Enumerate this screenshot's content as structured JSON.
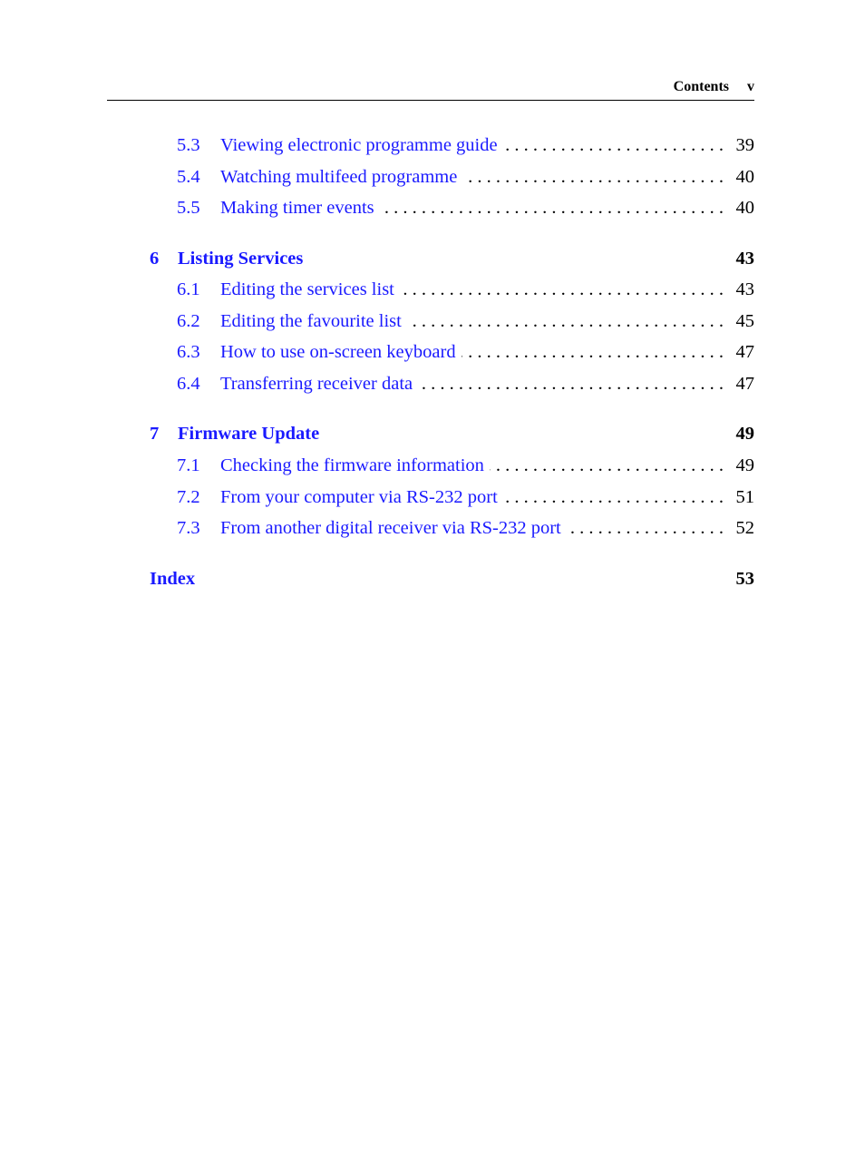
{
  "header": {
    "title": "Contents",
    "page_number": "v"
  },
  "toc": {
    "groups": [
      {
        "sections": [
          {
            "number": "5.3",
            "title": "Viewing electronic programme guide",
            "page": "39"
          },
          {
            "number": "5.4",
            "title": "Watching multifeed programme",
            "page": "40"
          },
          {
            "number": "5.5",
            "title": "Making timer events",
            "page": "40"
          }
        ]
      },
      {
        "chapter": {
          "number": "6",
          "title": "Listing Services",
          "page": "43"
        },
        "sections": [
          {
            "number": "6.1",
            "title": "Editing the services list",
            "page": "43"
          },
          {
            "number": "6.2",
            "title": "Editing the favourite list",
            "page": "45"
          },
          {
            "number": "6.3",
            "title": "How to use on-screen keyboard",
            "page": "47"
          },
          {
            "number": "6.4",
            "title": "Transferring receiver data",
            "page": "47"
          }
        ]
      },
      {
        "chapter": {
          "number": "7",
          "title": "Firmware Update",
          "page": "49"
        },
        "sections": [
          {
            "number": "7.1",
            "title": "Checking the firmware information",
            "page": "49"
          },
          {
            "number": "7.2",
            "title": "From your computer via RS-232 port",
            "page": "51"
          },
          {
            "number": "7.3",
            "title": "From another digital receiver via RS-232 port",
            "page": "52"
          }
        ]
      },
      {
        "chapter": {
          "number": "",
          "title": "Index",
          "page": "53"
        }
      }
    ]
  },
  "colors": {
    "link": "#1a1aff",
    "text": "#000000"
  }
}
